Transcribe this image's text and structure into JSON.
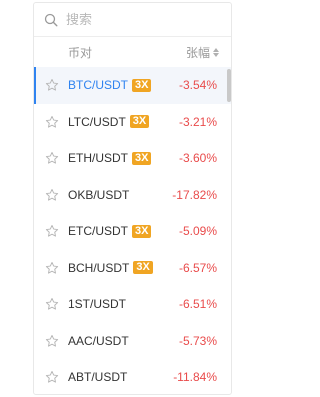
{
  "search": {
    "placeholder": "搜索",
    "icon": "search-icon"
  },
  "header": {
    "pair_label": "币对",
    "change_label": "张幅"
  },
  "colors": {
    "accent": "#2f83f0",
    "negative": "#e94b4b",
    "leverage_badge": "#f0a523"
  },
  "rows": [
    {
      "pair": "BTC/USDT",
      "leverage": "3X",
      "change": "-3.54%",
      "selected": true
    },
    {
      "pair": "LTC/USDT",
      "leverage": "3X",
      "change": "-3.21%"
    },
    {
      "pair": "ETH/USDT",
      "leverage": "3X",
      "change": "-3.60%"
    },
    {
      "pair": "OKB/USDT",
      "leverage": "",
      "change": "-17.82%"
    },
    {
      "pair": "ETC/USDT",
      "leverage": "3X",
      "change": "-5.09%"
    },
    {
      "pair": "BCH/USDT",
      "leverage": "3X",
      "change": "-6.57%"
    },
    {
      "pair": "1ST/USDT",
      "leverage": "",
      "change": "-6.51%"
    },
    {
      "pair": "AAC/USDT",
      "leverage": "",
      "change": "-5.73%"
    },
    {
      "pair": "ABT/USDT",
      "leverage": "",
      "change": "-11.84%"
    }
  ]
}
